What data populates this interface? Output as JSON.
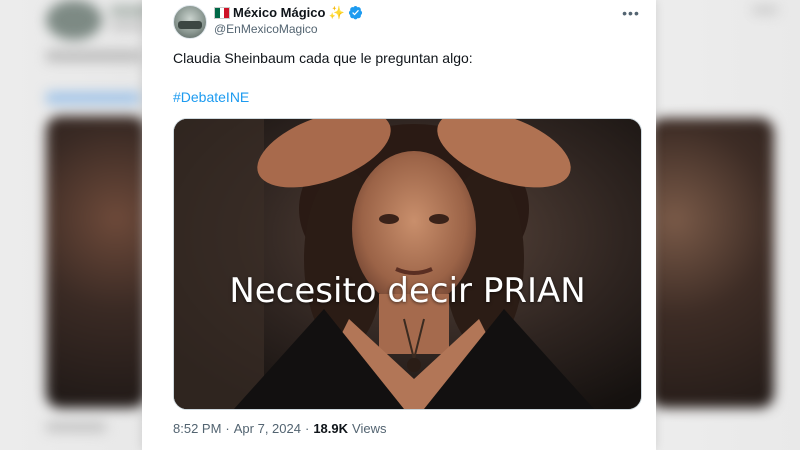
{
  "tweet": {
    "display_name": "México Mágico",
    "handle": "@EnMexicoMagico",
    "flag_icon": "mexico-flag-icon",
    "sparkle_icon": "sparkles-icon",
    "verified_icon": "verified-badge-icon",
    "more_icon": "more-horizontal-icon",
    "text": "Claudia Sheinbaum cada que le preguntan algo:",
    "hashtag": "#DebateINE",
    "media_caption": "Necesito decir PRIAN",
    "time": "8:52 PM",
    "separator": "·",
    "date": "Apr 7, 2024",
    "separator2": "·",
    "views_count": "18.9K",
    "views_label": "Views"
  },
  "colors": {
    "link": "#1d9bf0",
    "verified": "#1d9bf0",
    "text": "#0f1419",
    "secondary": "#536471",
    "flag_green": "#006847",
    "flag_white": "#ffffff",
    "flag_red": "#ce1126"
  }
}
